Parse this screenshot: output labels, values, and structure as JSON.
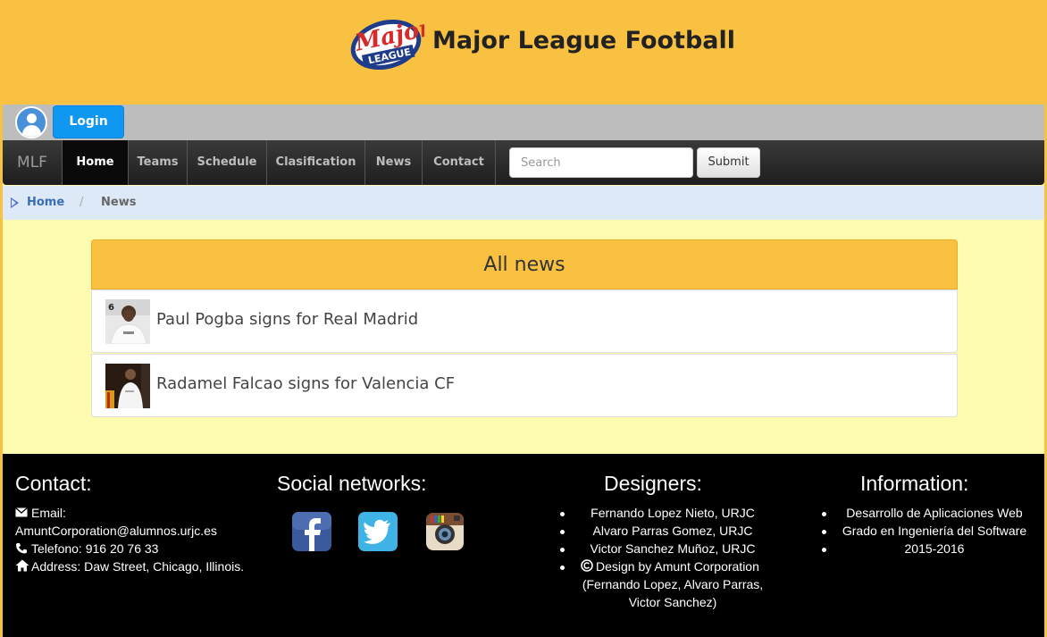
{
  "header": {
    "site_title": "Major League Football",
    "logo_icon": "major-league-logo"
  },
  "login": {
    "label": "Login",
    "avatar_icon": "user-avatar-icon"
  },
  "navbar": {
    "brand": "MLF",
    "items": [
      {
        "label": "Home",
        "active": true
      },
      {
        "label": "Teams"
      },
      {
        "label": "Schedule"
      },
      {
        "label": "Clasification"
      },
      {
        "label": "News"
      },
      {
        "label": "Contact"
      }
    ],
    "search_placeholder": "Search",
    "submit_label": "Submit"
  },
  "breadcrumb": {
    "home": "Home",
    "separator": "/",
    "current": "News"
  },
  "news_panel": {
    "title": "All news",
    "items": [
      {
        "title": "Paul Pogba signs for Real Madrid"
      },
      {
        "title": "Radamel Falcao signs for Valencia CF"
      }
    ]
  },
  "footer": {
    "contact": {
      "heading": "Contact:",
      "email_label": "Email:",
      "email": "AmuntCorporation@alumnos.urjc.es",
      "phone": "Telefono: 916 20 76 33",
      "address": "Address: Daw Street, Chicago, Illinois."
    },
    "social": {
      "heading": "Social networks:",
      "icons": [
        "facebook-icon",
        "twitter-icon",
        "instagram-icon"
      ]
    },
    "designers": {
      "heading": "Designers:",
      "items": [
        "Fernando Lopez Nieto, URJC",
        "Alvaro Parras Gomez, URJC",
        "Victor Sanchez Muñoz, URJC",
        "Design by Amunt Corporation",
        "(Fernando Lopez, Alvaro Parras,",
        "Victor Sanchez)"
      ]
    },
    "information": {
      "heading": "Information:",
      "items": [
        "Desarrollo de Aplicaciones Web",
        "Grado en Ingeniería del Software",
        "2015-2016"
      ]
    }
  },
  "colors": {
    "header_bg": "#f8c141",
    "page_bg": "#fcfbb0",
    "login_blue": "#0f97f1",
    "navbar_bg": "#222222"
  }
}
